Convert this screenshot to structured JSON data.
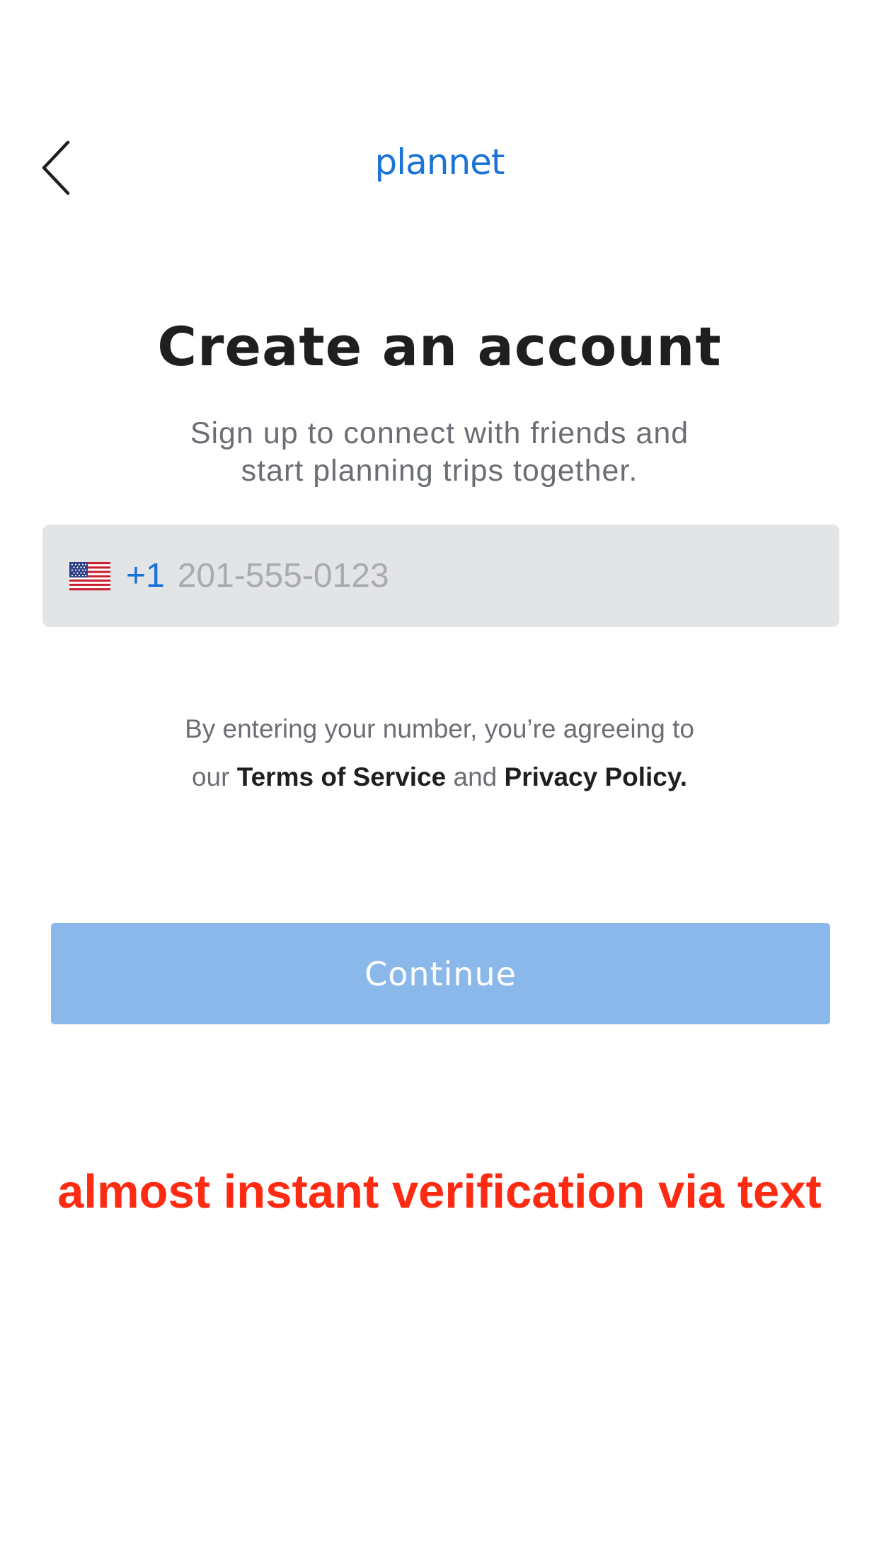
{
  "header": {
    "back_icon": "chevron-left-icon",
    "logo_text": "plannet"
  },
  "signup": {
    "title": "Create an account",
    "subtitle_line1": "Sign up to connect with friends and",
    "subtitle_line2": "start planning trips together.",
    "phone": {
      "flag_icon": "us-flag-icon",
      "dial_code": "+1",
      "placeholder": "201-555-0123",
      "value": ""
    },
    "legal": {
      "line1": "By entering your number, you’re agreeing to",
      "prefix": "our",
      "terms_label": "Terms of Service",
      "conjunction": "and",
      "privacy_label": "Privacy Policy."
    },
    "continue_label": "Continue"
  },
  "annotation": {
    "text": "almost instant verification via text"
  },
  "colors": {
    "accent": "#1a73d9",
    "button_disabled": "#8ab8ea",
    "field_background": "#e3e4e6",
    "annotation": "#ff2a12",
    "title": "#1f1f21",
    "secondary_text": "#6b6e75"
  }
}
